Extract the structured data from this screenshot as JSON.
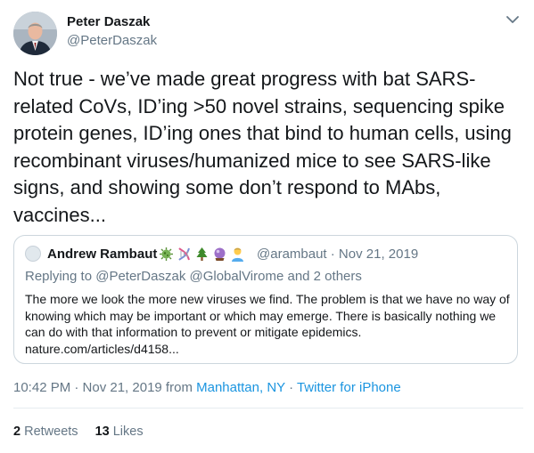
{
  "tweet": {
    "author_name": "Peter Daszak",
    "author_handle": "@PeterDaszak",
    "text": "Not true - we’ve made great progress with bat SARS-related CoVs, ID’ing >50 novel strains, sequencing spike protein genes, ID’ing ones that bind to human cells, using recombinant viruses/humanized mice to see SARS-like signs, and showing some don’t respond to MAbs, vaccines...",
    "time": "10:42 PM · Nov 21, 2019 from ",
    "location": "Manhattan, NY",
    "separator": " · ",
    "source": "Twitter for iPhone"
  },
  "quoted": {
    "author_name": "Andrew Rambaut",
    "emoji_icons": [
      "microbe-icon",
      "dna-icon",
      "evergreen-tree-icon",
      "crystal-ball-icon",
      "person-icon"
    ],
    "handle_date": "@arambaut · Nov 21, 2019",
    "replying_prefix": "Replying to ",
    "replying_users": "@PeterDaszak @GlobalVirome",
    "replying_suffix": " and 2 others",
    "text": "The more we look the more new viruses we find. The problem is that we have no way of knowing which may be important or which may emerge. There is basically nothing we can do with that information to prevent or mitigate epidemics. nature.com/articles/d4158..."
  },
  "stats": {
    "retweets_count": "2",
    "retweets_label": "Retweets",
    "likes_count": "13",
    "likes_label": "Likes"
  },
  "colors": {
    "link": "#1b95e0",
    "secondary": "#657786",
    "border": "#ccd6dd"
  }
}
